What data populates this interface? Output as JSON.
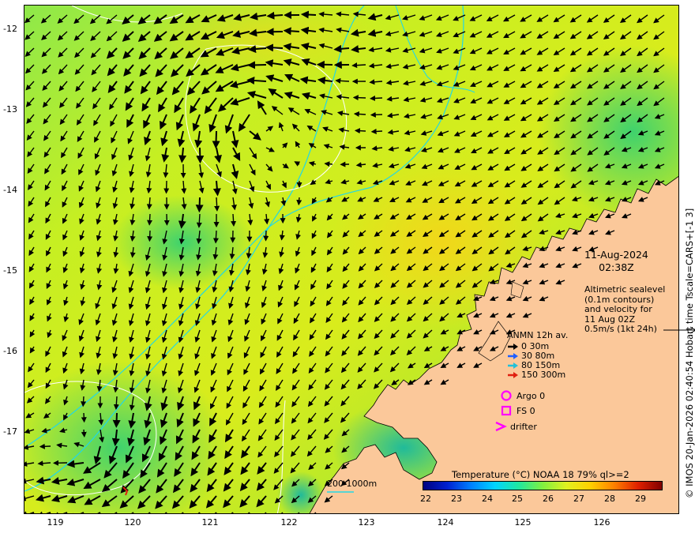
{
  "map": {
    "y_ticks": [
      "-12",
      "-13",
      "-14",
      "-15",
      "-16",
      "-17"
    ],
    "x_ticks": [
      "119",
      "120",
      "121",
      "122",
      "123",
      "124",
      "125",
      "126"
    ],
    "date": "11-Aug-2024",
    "time": "02:38Z",
    "altimetry_lines": [
      "Altimetric sealevel",
      "(0.1m contours)",
      "and velocity for",
      "11 Aug 02Z",
      "0.5m/s (1kt 24h)"
    ],
    "legend_title": "ANMN 12h av.",
    "legend_items": [
      {
        "label": "0 30m",
        "color": "#000000"
      },
      {
        "label": "30 80m",
        "color": "#1f5fff"
      },
      {
        "label": "80 150m",
        "color": "#22c0d8"
      },
      {
        "label": "150 300m",
        "color": "#e02010"
      }
    ],
    "argo_label": "Argo 0",
    "fs_label": "FS 0",
    "drifter_label": "drifter",
    "marker_color": "#ff00ff",
    "colorbar_title": "Temperature (°C) NOAA 18 79% ql>=2",
    "colorbar_ticks": [
      "22",
      "23",
      "24",
      "25",
      "26",
      "27",
      "28",
      "29"
    ],
    "contour_key": "200  1000m",
    "vertical_caption": "© IMOS 20-Jan-2026 02:40:54 Hobart time Tscale=CARS+[-1 3]",
    "colors": {
      "land": "#fbc89a",
      "isobath": "#22d7e6",
      "contour": "#ffffff",
      "sst_ramp": [
        "#00007f",
        "#0020d0",
        "#0080ff",
        "#00d4ff",
        "#20e8a0",
        "#80f040",
        "#e0f020",
        "#ffd000",
        "#ff8000",
        "#e02000",
        "#800000"
      ]
    }
  }
}
